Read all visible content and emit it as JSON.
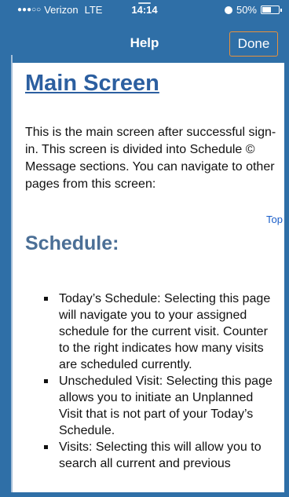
{
  "status_bar": {
    "signal": "●●●○○",
    "carrier": "Verizon",
    "network": "LTE",
    "time": "14:14",
    "battery_percent": "50%",
    "battery_level": 0.5
  },
  "nav": {
    "title": "Help",
    "done_label": "Done"
  },
  "content": {
    "page_title": "Main Screen",
    "intro": "This is the main screen after successful sign-in. This screen is divided into Schedule © Message sections. You can navigate to other pages from this screen:",
    "top_link": "Top",
    "section_title": "Schedule:",
    "bullets": [
      "Today’s Schedule: Selecting this page will navigate you to your assigned schedule for the current visit. Counter to the right indicates how many visits are scheduled currently.",
      "Unscheduled Visit: Selecting this page allows you to initiate an Unplanned Visit that is not part of your Today’s Schedule.",
      "Visits: Selecting this will allow you to search all current and previous"
    ]
  },
  "colors": {
    "brand_blue": "#2f6fa7",
    "done_border": "#e8913c",
    "title_blue": "#2c5fa0",
    "link_blue": "#1a5ec9"
  }
}
